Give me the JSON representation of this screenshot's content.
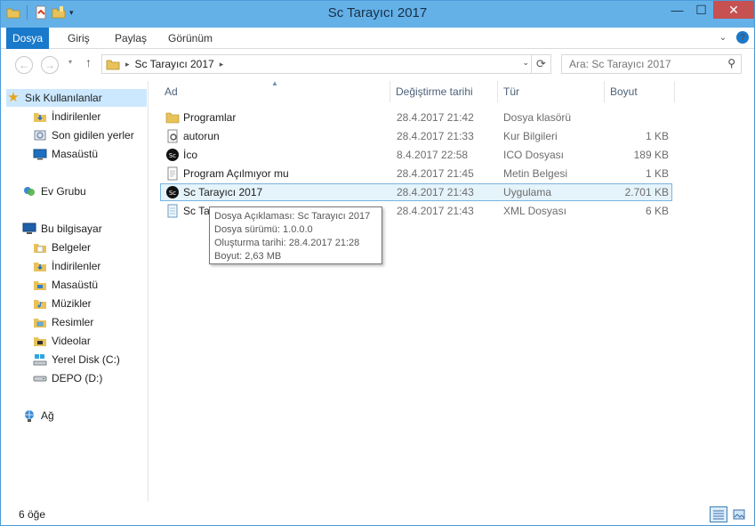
{
  "window": {
    "title": "Sc Tarayıcı 2017"
  },
  "caption": {
    "minimize": "—",
    "maximize": "☐",
    "close": "✕"
  },
  "ribbon": {
    "tabs": [
      {
        "label": "Dosya"
      },
      {
        "label": "Giriş"
      },
      {
        "label": "Paylaş"
      },
      {
        "label": "Görünüm"
      }
    ],
    "minimize_chevron": "⌄",
    "help": "?"
  },
  "navigation": {
    "back": "←",
    "forward": "→",
    "recent_dropdown": "▾",
    "up": "↑",
    "breadcrumb": [
      "Sc Tarayıcı 2017"
    ],
    "address_dropdown": "⌄",
    "refresh": "⟳",
    "search_placeholder": "Ara: Sc Tarayıcı 2017",
    "search_icon": "⚲"
  },
  "nav_pane": {
    "favorites_label": "Sık Kullanılanlar",
    "favorites": [
      "İndirilenler",
      "Son gidilen yerler",
      "Masaüstü"
    ],
    "homegroup_label": "Ev Grubu",
    "computer_label": "Bu bilgisayar",
    "computer_items": [
      "Belgeler",
      "İndirilenler",
      "Masaüstü",
      "Müzikler",
      "Resimler",
      "Videolar",
      "Yerel Disk (C:)",
      "DEPO (D:)"
    ],
    "network_label": "Ağ"
  },
  "columns": {
    "name": "Ad",
    "modified": "Değiştirme tarihi",
    "type": "Tür",
    "size": "Boyut"
  },
  "files": [
    {
      "name": "Programlar",
      "modified": "28.4.2017 21:42",
      "type": "Dosya klasörü",
      "size": "",
      "icon": "folder-icon"
    },
    {
      "name": "autorun",
      "modified": "28.4.2017 21:33",
      "type": "Kur Bilgileri",
      "size": "1 KB",
      "icon": "setup-info-icon"
    },
    {
      "name": "İco",
      "modified": "8.4.2017 22:58",
      "type": "ICO Dosyası",
      "size": "189 KB",
      "icon": "sc-icon"
    },
    {
      "name": "Program Açılmıyor mu",
      "modified": "28.4.2017 21:45",
      "type": "Metin Belgesi",
      "size": "1 KB",
      "icon": "text-document-icon"
    },
    {
      "name": "Sc Tarayıcı 2017",
      "modified": "28.4.2017 21:43",
      "type": "Uygulama",
      "size": "2.701 KB",
      "icon": "sc-icon"
    },
    {
      "name": "Sc Ta",
      "modified": "28.4.2017 21:43",
      "type": "XML Dosyası",
      "size": "6 KB",
      "icon": "xml-document-icon"
    }
  ],
  "tooltip": {
    "lines": [
      "Dosya Açıklaması: Sc Tarayıcı 2017",
      "Dosya sürümü: 1.0.0.0",
      "Oluşturma tarihi: 28.4.2017 21:28",
      "Boyut: 2,63 MB"
    ]
  },
  "status": {
    "item_count": "6 öğe"
  },
  "colors": {
    "titlebar": "#64b1e8",
    "file_tab": "#1979ca",
    "selection": "#e5f3fb",
    "selection_border": "#7ab5e0",
    "close": "#c75050"
  }
}
